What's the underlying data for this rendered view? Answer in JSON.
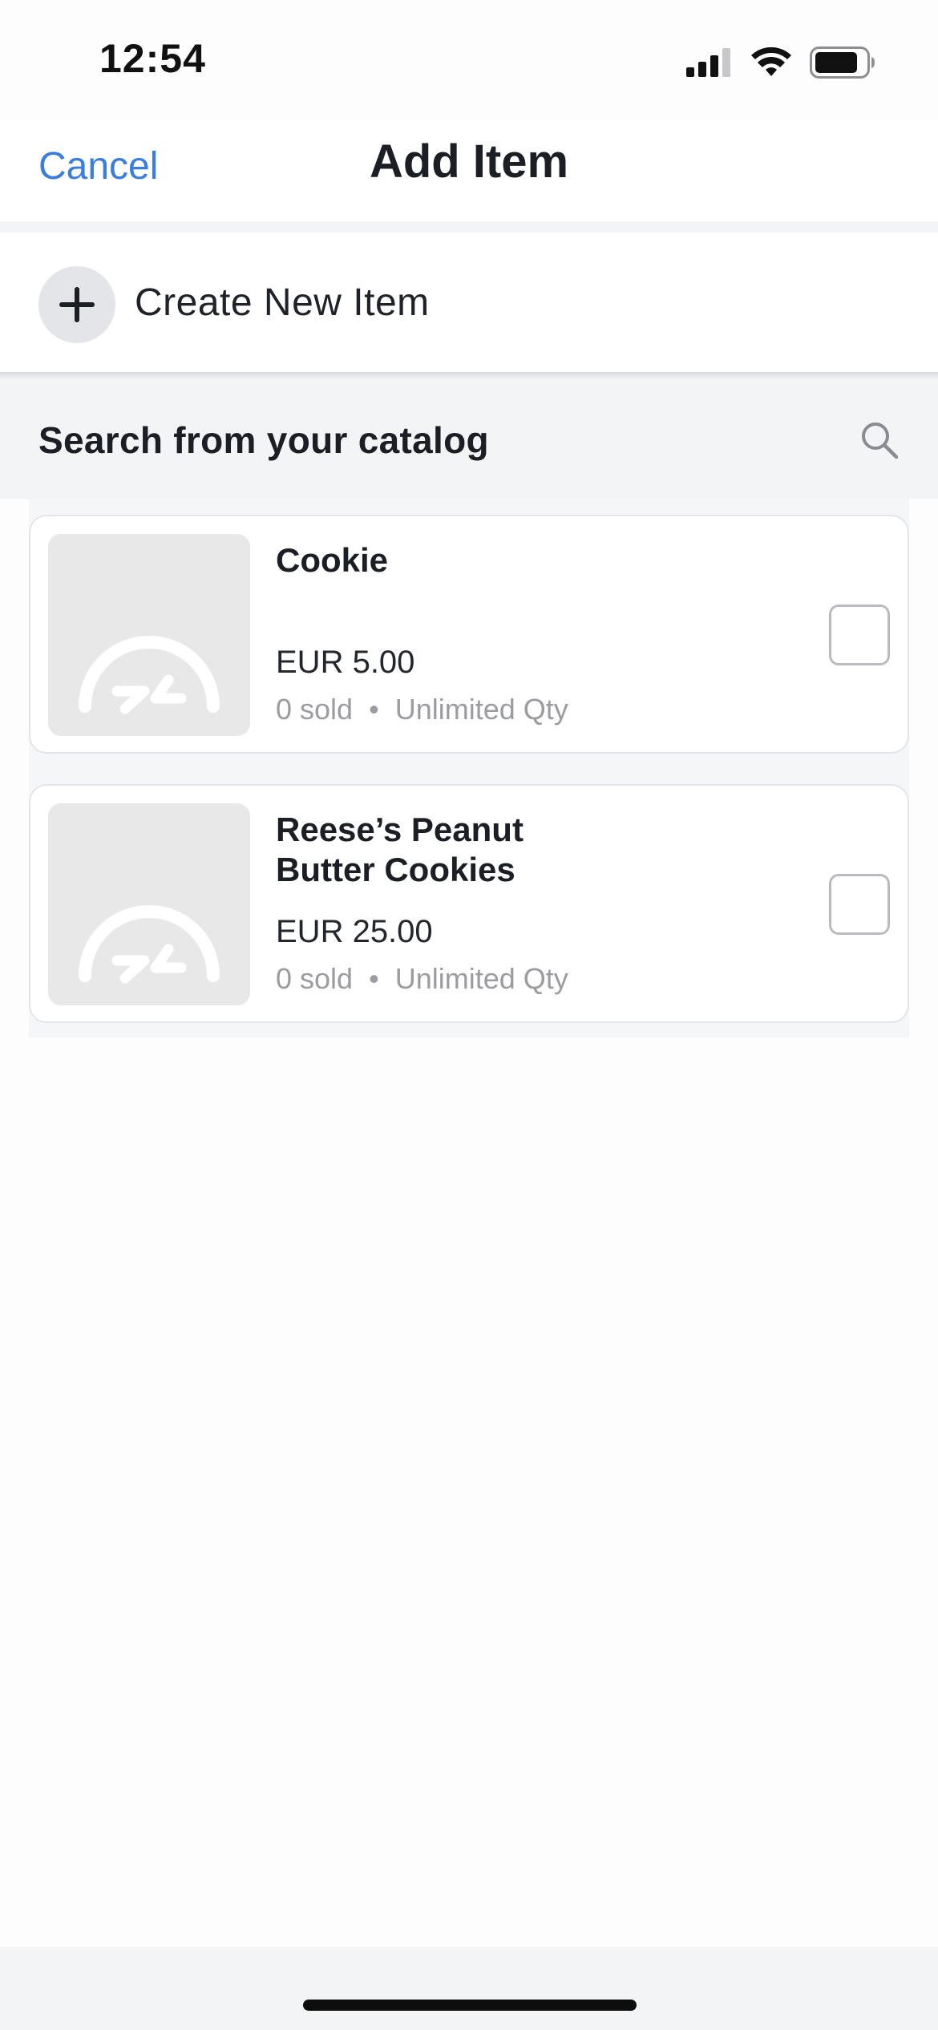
{
  "status_bar": {
    "time": "12:54",
    "icons": [
      "cellular-signal-icon",
      "wifi-icon",
      "battery-icon"
    ]
  },
  "nav": {
    "cancel_label": "Cancel",
    "title": "Add Item"
  },
  "create": {
    "label": "Create New Item",
    "icon": "plus-icon"
  },
  "catalog": {
    "heading": "Search from your catalog",
    "search_icon": "search-icon"
  },
  "items": [
    {
      "name": "Cookie",
      "price": "EUR 5.00",
      "sold": "0 sold",
      "separator": "•",
      "qty": "Unlimited Qty",
      "checked": false
    },
    {
      "name": "Reese’s Peanut Butter Cookies",
      "price": "EUR 25.00",
      "sold": "0 sold",
      "separator": "•",
      "qty": "Unlimited Qty",
      "checked": false
    }
  ],
  "colors": {
    "accent": "#3b7ddd",
    "text_primary": "#1b1e24",
    "text_secondary": "#9a9ca1",
    "section_bg": "#f3f4f6"
  }
}
